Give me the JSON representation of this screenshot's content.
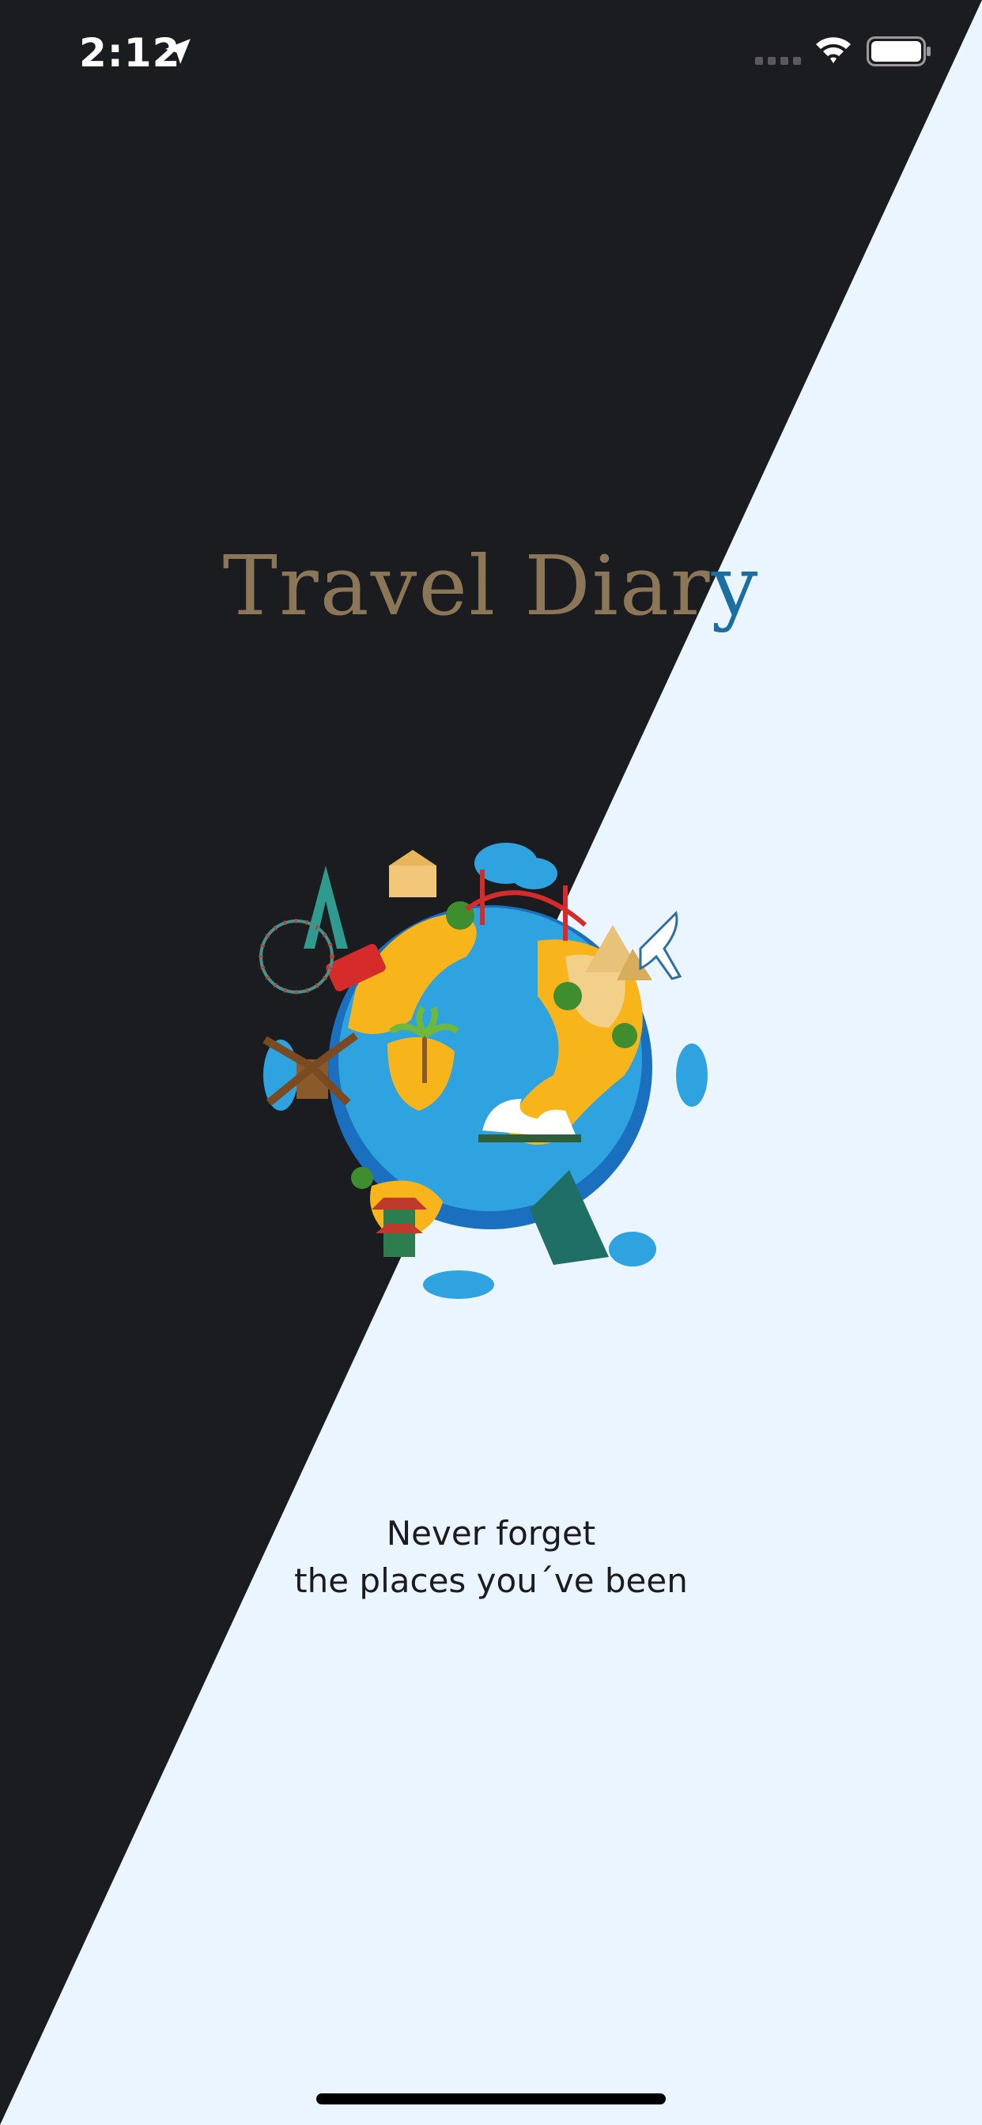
{
  "status_bar": {
    "time": "2:12",
    "icons": [
      "location-arrow-icon",
      "cellular-signal-icon",
      "wifi-icon",
      "battery-icon"
    ]
  },
  "app": {
    "title_main": "Travel Diar",
    "title_last": "y",
    "tagline_line1": "Never forget",
    "tagline_line2": "the places you´ve been"
  },
  "colors": {
    "dark_bg": "#1b1c1f",
    "light_bg": "#ebf5ff",
    "title_brown": "#8b7657",
    "title_blue": "#1b6ea0",
    "tagline_text": "#1b1c1f"
  }
}
